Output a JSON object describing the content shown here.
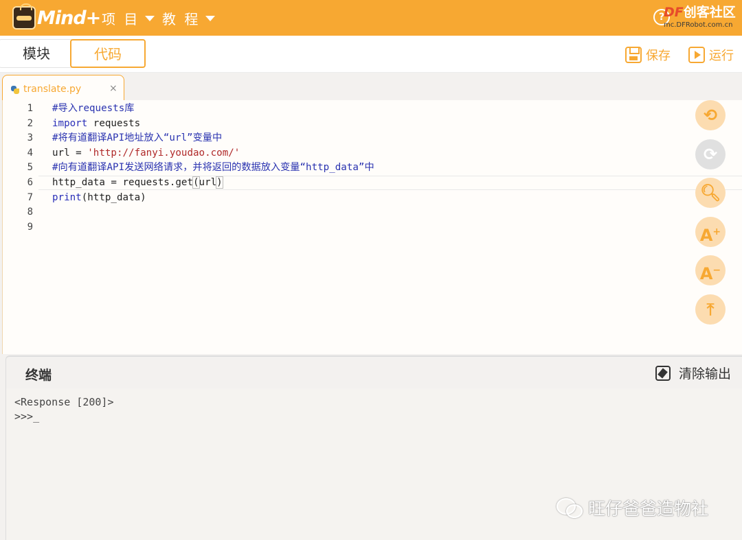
{
  "header": {
    "logo_text": "Mind+",
    "menu": [
      {
        "label": "项 目"
      },
      {
        "label": "教 程"
      }
    ],
    "help_icon": "question-circle-icon",
    "watermark_title_prefix": "DF",
    "watermark_title": "创客社区",
    "watermark_url": "mc.DFRobot.com.cn",
    "accent_color": "#f7a832"
  },
  "modebar": {
    "tabs": [
      {
        "label": "模块",
        "active": false
      },
      {
        "label": "代码",
        "active": true
      }
    ],
    "save_label": "保存",
    "run_label": "运行"
  },
  "file_tab": {
    "name": "translate.py",
    "close": "×"
  },
  "editor": {
    "line_numbers": [
      "1",
      "2",
      "3",
      "4",
      "5",
      "6",
      "7",
      "8",
      "9"
    ],
    "lines": [
      {
        "segments": [
          {
            "cls": "cmt",
            "text": "#导入requests库"
          }
        ]
      },
      {
        "segments": [
          {
            "cls": "kw",
            "text": "import"
          },
          {
            "cls": "",
            "text": " requests"
          }
        ]
      },
      {
        "segments": [
          {
            "cls": "cmt",
            "text": "#将有道翻译API地址放入“url”变量中"
          }
        ]
      },
      {
        "segments": [
          {
            "cls": "",
            "text": "url = "
          },
          {
            "cls": "str",
            "text": "'http://fanyi.youdao.com/'"
          }
        ]
      },
      {
        "segments": [
          {
            "cls": "cmt",
            "text": "#向有道翻译API发送网络请求，并将返回的数据放入变量“http_data”中"
          }
        ]
      },
      {
        "segments": [
          {
            "cls": "",
            "text": "http_data = requests.get"
          },
          {
            "cls": "bracket",
            "text": "("
          },
          {
            "cls": "",
            "text": "url"
          },
          {
            "cls": "bracket",
            "text": ")"
          }
        ]
      },
      {
        "segments": [
          {
            "cls": "kw",
            "text": "print"
          },
          {
            "cls": "",
            "text": "(http_data)"
          }
        ]
      },
      {
        "segments": []
      },
      {
        "segments": []
      }
    ],
    "side_tools": [
      {
        "name": "undo-icon",
        "glyph": "⟲",
        "disabled": false
      },
      {
        "name": "redo-icon",
        "glyph": "⟳",
        "disabled": true
      },
      {
        "name": "search-icon",
        "glyph": "🔍︎",
        "disabled": false
      },
      {
        "name": "font-increase-icon",
        "glyph": "A",
        "sup": "+",
        "disabled": false
      },
      {
        "name": "font-decrease-icon",
        "glyph": "A",
        "sup": "−",
        "disabled": false
      },
      {
        "name": "scroll-top-icon",
        "glyph": "⤒",
        "disabled": false
      }
    ]
  },
  "terminal": {
    "title": "终端",
    "clear_label": "清除输出",
    "output": [
      "<Response [200]>",
      ">>>_"
    ]
  },
  "watermark_bottom": "旺仔爸爸造物社"
}
